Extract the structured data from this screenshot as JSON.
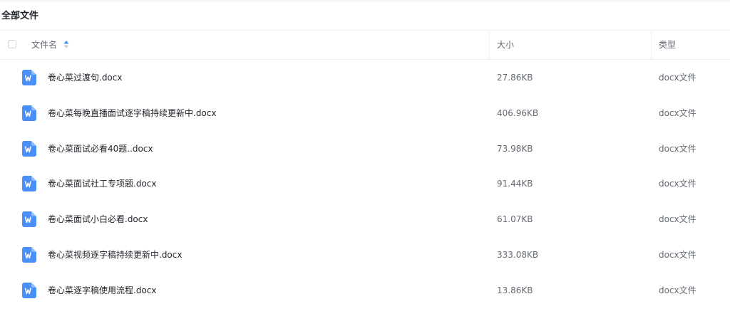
{
  "page": {
    "title": "全部文件"
  },
  "table": {
    "columns": {
      "name": "文件名",
      "size": "大小",
      "type": "类型"
    },
    "rows": [
      {
        "name": "卷心菜过渡句.docx",
        "size": "27.86KB",
        "type": "docx文件",
        "icon": "word-doc-icon"
      },
      {
        "name": "卷心菜每晚直播面试逐字稿持续更新中.docx",
        "size": "406.96KB",
        "type": "docx文件",
        "icon": "word-doc-icon"
      },
      {
        "name": "卷心菜面试必看40题..docx",
        "size": "73.98KB",
        "type": "docx文件",
        "icon": "word-doc-icon"
      },
      {
        "name": "卷心菜面试社工专项题.docx",
        "size": "91.44KB",
        "type": "docx文件",
        "icon": "word-doc-icon"
      },
      {
        "name": "卷心菜面试小白必看.docx",
        "size": "61.07KB",
        "type": "docx文件",
        "icon": "word-doc-icon"
      },
      {
        "name": "卷心菜视频逐字稿持续更新中.docx",
        "size": "333.08KB",
        "type": "docx文件",
        "icon": "word-doc-icon"
      },
      {
        "name": "卷心菜逐字稿使用流程.docx",
        "size": "13.86KB",
        "type": "docx文件",
        "icon": "word-doc-icon"
      }
    ]
  },
  "colors": {
    "accent": "#3d8bf7",
    "icon_blue": "#4a8ef8",
    "text": "#1f2329",
    "muted": "#646a73",
    "divider": "#eef0f2"
  }
}
